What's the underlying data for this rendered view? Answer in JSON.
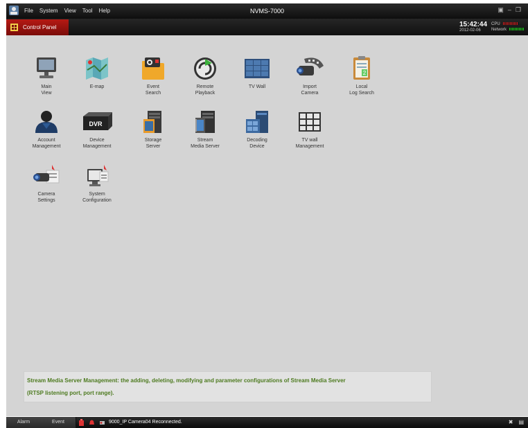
{
  "window": {
    "title": "NVMS-7000",
    "menu": [
      "File",
      "System",
      "View",
      "Tool",
      "Help"
    ]
  },
  "tab": {
    "label": "Control Panel"
  },
  "clock": {
    "time": "15:42:44",
    "date": "2012-02-06"
  },
  "meters": {
    "cpu_label": "CPU",
    "network_label": "Network"
  },
  "tiles": [
    {
      "label": "Main\nView",
      "icon": "monitor-icon"
    },
    {
      "label": "E-map",
      "icon": "map-icon"
    },
    {
      "label": "Event\nSearch",
      "icon": "event-folder-icon"
    },
    {
      "label": "Remote\nPlayback",
      "icon": "playback-icon"
    },
    {
      "label": "TV Wall",
      "icon": "tv-wall-icon"
    },
    {
      "label": "Import\nCamera",
      "icon": "camera-film-icon"
    },
    {
      "label": "Local\nLog Search",
      "icon": "clipboard-icon"
    },
    {
      "label": "Account\nManagement",
      "icon": "user-icon"
    },
    {
      "label": "Device\nManagement",
      "icon": "dvr-icon"
    },
    {
      "label": "Storage\nServer",
      "icon": "storage-server-icon"
    },
    {
      "label": "Stream\nMedia Server",
      "icon": "media-server-icon"
    },
    {
      "label": "Decoding\nDevice",
      "icon": "decoder-icon"
    },
    {
      "label": "TV wall\nManagement",
      "icon": "grid-icon"
    },
    {
      "label": "Camera\nSettings",
      "icon": "camera-settings-icon"
    },
    {
      "label": "System\nConfiguration",
      "icon": "system-config-icon"
    }
  ],
  "info": {
    "line1": "Stream Media Server  Management: the adding, deleting, modifying and parameter configurations of Stream Media Server",
    "line2": "(RTSP listening port, port range)."
  },
  "status": {
    "alarm_label": "Alarm",
    "event_label": "Event",
    "message": "9000_IP Camera04 Reconnected."
  }
}
